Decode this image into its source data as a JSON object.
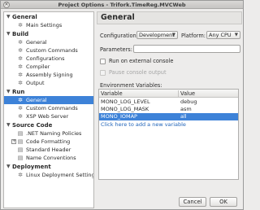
{
  "window": {
    "title": "Project Options - Trifork.TimeReg.MVCWeb",
    "close_glyph": "✕"
  },
  "sidebar": {
    "sections": [
      {
        "label": "General",
        "items": [
          {
            "label": "Main Settings",
            "icon": "gear-icon",
            "glyph": "✲"
          }
        ]
      },
      {
        "label": "Build",
        "items": [
          {
            "label": "General",
            "icon": "gear-icon",
            "glyph": "✲"
          },
          {
            "label": "Custom Commands",
            "icon": "gear-icon",
            "glyph": "✲"
          },
          {
            "label": "Configurations",
            "icon": "gear-icon",
            "glyph": "✲"
          },
          {
            "label": "Compiler",
            "icon": "gear-icon",
            "glyph": "✲"
          },
          {
            "label": "Assembly Signing",
            "icon": "gear-icon",
            "glyph": "✲"
          },
          {
            "label": "Output",
            "icon": "gear-icon",
            "glyph": "✲"
          }
        ]
      },
      {
        "label": "Run",
        "items": [
          {
            "label": "General",
            "icon": "gear-icon",
            "glyph": "✲",
            "selected": true
          },
          {
            "label": "Custom Commands",
            "icon": "gear-icon",
            "glyph": "✲"
          },
          {
            "label": "XSP Web Server",
            "icon": "gear-icon",
            "glyph": "✲"
          }
        ]
      },
      {
        "label": "Source Code",
        "items": [
          {
            "label": ".NET Naming Policies",
            "icon": "document-icon",
            "glyph": "▤"
          },
          {
            "label": "Code Formatting",
            "icon": "document-icon",
            "glyph": "▤",
            "expander": "+"
          },
          {
            "label": "Standard Header",
            "icon": "document-icon",
            "glyph": "▤"
          },
          {
            "label": "Name Conventions",
            "icon": "document-icon",
            "glyph": "▤"
          }
        ]
      },
      {
        "label": "Deployment",
        "items": [
          {
            "label": "Linux Deployment Settings",
            "icon": "gear-icon",
            "glyph": "✲"
          }
        ]
      }
    ],
    "section_arrow": "▼"
  },
  "pane": {
    "title": "General",
    "configuration_label": "Configuration:",
    "configuration_value": "Development",
    "platform_label": "Platform:",
    "platform_value": "Any CPU",
    "combo_arrow": "▼",
    "parameters_label": "Parameters:",
    "parameters_value": "",
    "run_external_label": "Run on external console",
    "pause_output_label": "Pause console output",
    "env_label": "Environment Variables:",
    "env_columns": [
      "Variable",
      "Value"
    ],
    "env_rows": [
      {
        "variable": "MONO_LOG_LEVEL",
        "value": "debug"
      },
      {
        "variable": "MONO_LOG_MASK",
        "value": "asm"
      },
      {
        "variable": "MONO_IOMAP",
        "value": "all",
        "selected": true
      }
    ],
    "add_variable_text": "Click here to add a new variable"
  },
  "buttons": {
    "cancel": "Cancel",
    "ok": "OK"
  },
  "colors": {
    "selection": "#3d82d8",
    "link": "#1f63b8"
  }
}
